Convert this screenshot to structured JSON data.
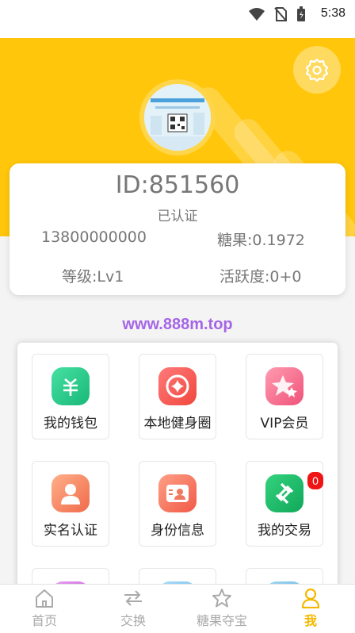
{
  "status_bar": {
    "time": "5:38"
  },
  "profile": {
    "id_text": "ID:851560",
    "verified_text": "已认证",
    "phone": "13800000000",
    "candy": "糖果:0.1972",
    "level": "等级:Lv1",
    "activity": "活跃度:0+0"
  },
  "watermark": "www.888m.top",
  "menu": {
    "wallet": "我的钱包",
    "fitness": "本地健身圈",
    "vip": "VIP会员",
    "real_name": "实名认证",
    "identity": "身份信息",
    "trades": "我的交易",
    "trades_badge": "0"
  },
  "tabs": {
    "home": "首页",
    "exchange": "交换",
    "treasure": "糖果夺宝",
    "me": "我"
  },
  "colors": {
    "header": "#ffc60b",
    "active_tab": "#f5b800",
    "badge": "#f01515",
    "watermark": "#a566e6"
  }
}
